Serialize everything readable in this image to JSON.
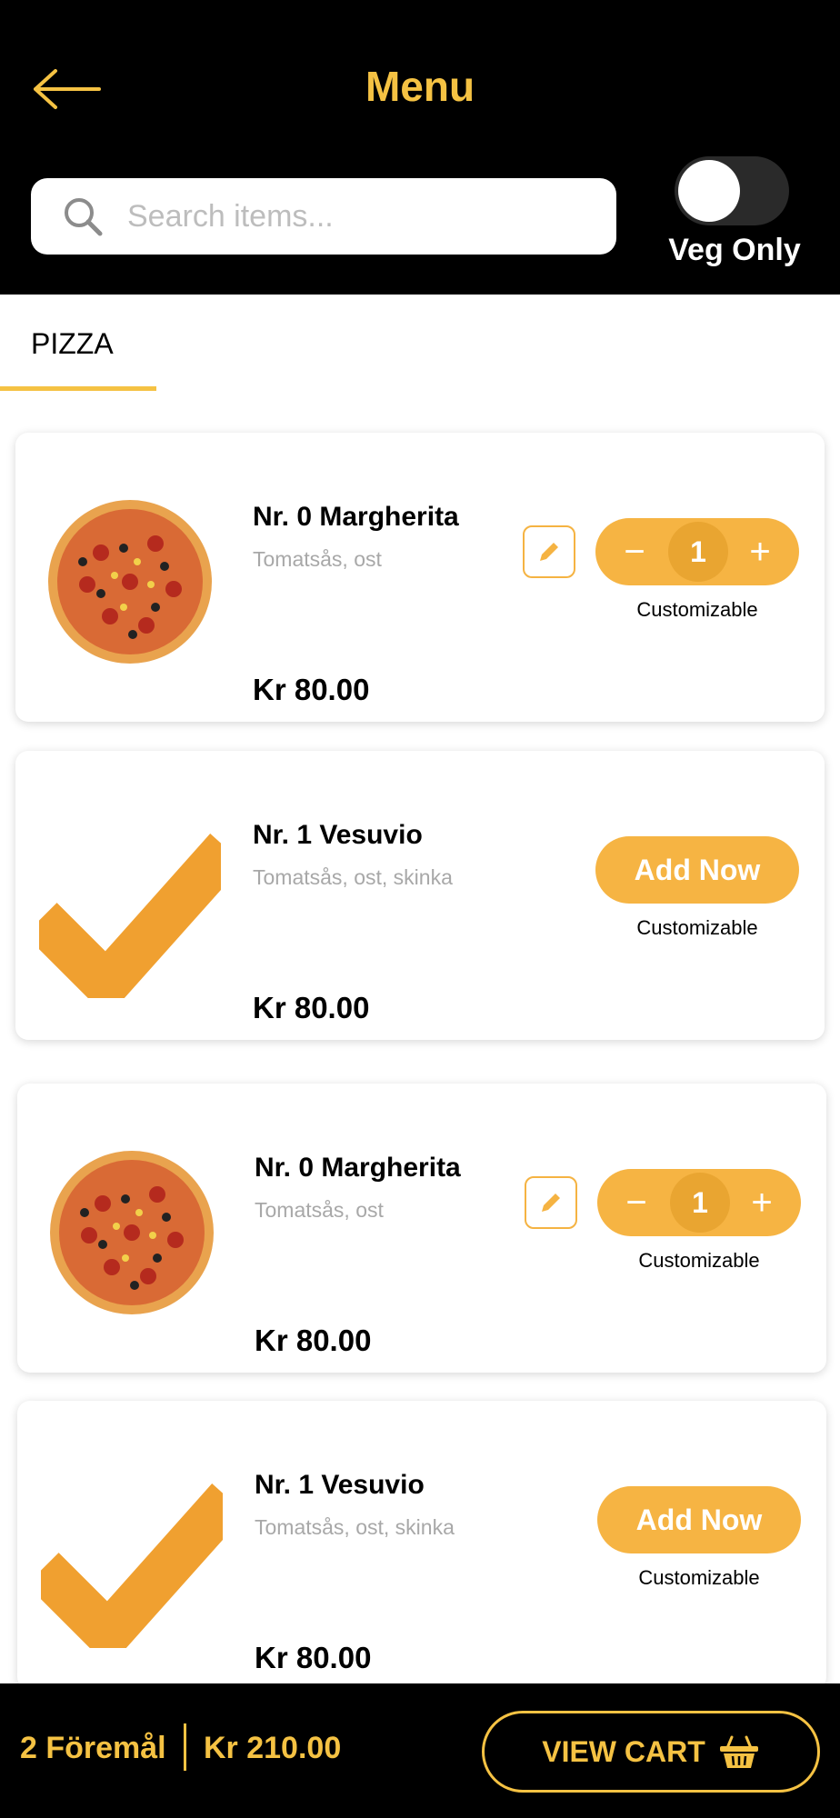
{
  "header": {
    "back_icon": "arrow-left-icon",
    "title": "Menu",
    "search_placeholder": "Search items...",
    "veg_label": "Veg Only",
    "veg_enabled": false,
    "accent_color": "#F5C243"
  },
  "tabs": [
    {
      "label": "PIZZA",
      "active": true
    }
  ],
  "items": [
    {
      "name": "Nr. 0 Margherita",
      "description": "Tomatsås, ost",
      "price": "Kr 80.00",
      "image": "pizza-image",
      "quantity": "1",
      "customizable": "Customizable",
      "in_cart": true
    },
    {
      "name": "Nr. 1 Vesuvio",
      "description": "Tomatsås, ost, skinka",
      "price": "Kr 80.00",
      "image": "checkmark-image",
      "add_label": "Add Now",
      "customizable": "Customizable",
      "in_cart": false
    },
    {
      "name": "Nr. 0 Margherita",
      "description": "Tomatsås, ost",
      "price": "Kr 80.00",
      "image": "pizza-image",
      "quantity": "1",
      "customizable": "Customizable",
      "in_cart": true
    },
    {
      "name": "Nr. 1 Vesuvio",
      "description": "Tomatsås, ost, skinka",
      "price": "Kr 80.00",
      "image": "checkmark-image",
      "add_label": "Add Now",
      "customizable": "Customizable",
      "in_cart": false
    }
  ],
  "cart": {
    "count_label": "2 Föremål",
    "total": "Kr 210.00",
    "button_label": "VIEW CART",
    "button_icon": "basket-icon"
  }
}
